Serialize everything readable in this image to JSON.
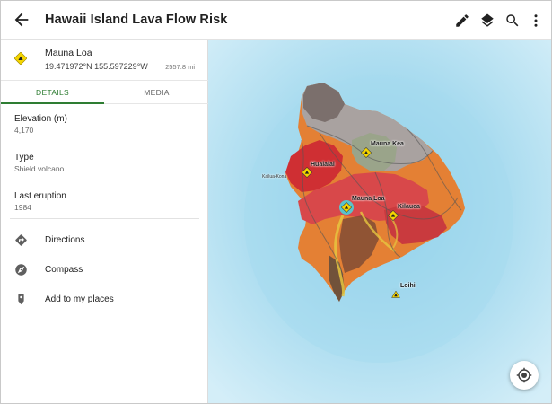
{
  "app": {
    "title": "Hawaii Island Lava Flow Risk"
  },
  "toolbar": {
    "back_icon": "arrow-left-icon",
    "edit_icon": "pencil-icon",
    "layers_icon": "layers-icon",
    "search_icon": "search-icon",
    "more_icon": "more-vert-icon"
  },
  "place": {
    "name": "Mauna Loa",
    "coordinates": "19.471972°N  155.597229°W",
    "distance": "2557.8 mi",
    "icon": "volcano-diamond-icon"
  },
  "tabs": [
    {
      "label": "DETAILS",
      "selected": true
    },
    {
      "label": "MEDIA",
      "selected": false
    }
  ],
  "details": [
    {
      "label": "Elevation (m)",
      "value": "4,170"
    },
    {
      "label": "Type",
      "value": "Shield volcano"
    },
    {
      "label": "Last eruption",
      "value": "1984"
    }
  ],
  "actions": [
    {
      "label": "Directions",
      "icon": "directions-icon"
    },
    {
      "label": "Compass",
      "icon": "compass-icon"
    },
    {
      "label": "Add to my places",
      "icon": "bookmark-pin-icon"
    }
  ],
  "map": {
    "markers": [
      {
        "label": "Mauna Kea",
        "icon": "volcano-diamond-icon"
      },
      {
        "label": "Hualalai",
        "icon": "volcano-diamond-icon"
      },
      {
        "label": "Mauna Loa",
        "icon": "volcano-diamond-icon",
        "selected": true
      },
      {
        "label": "Kilauea",
        "icon": "volcano-diamond-icon"
      },
      {
        "label": "Loihi",
        "icon": "volcano-triangle-icon"
      }
    ],
    "town_label": "Kailua-Kona",
    "locate_icon": "my-location-icon"
  },
  "colors": {
    "accent": "#2e7d32",
    "ocean": "#bfe6f4",
    "risk_high": "#d23a3a",
    "risk_medium": "#e07a2a",
    "marker_yellow": "#f4d400",
    "selected_marker": "#4dd0d8"
  }
}
